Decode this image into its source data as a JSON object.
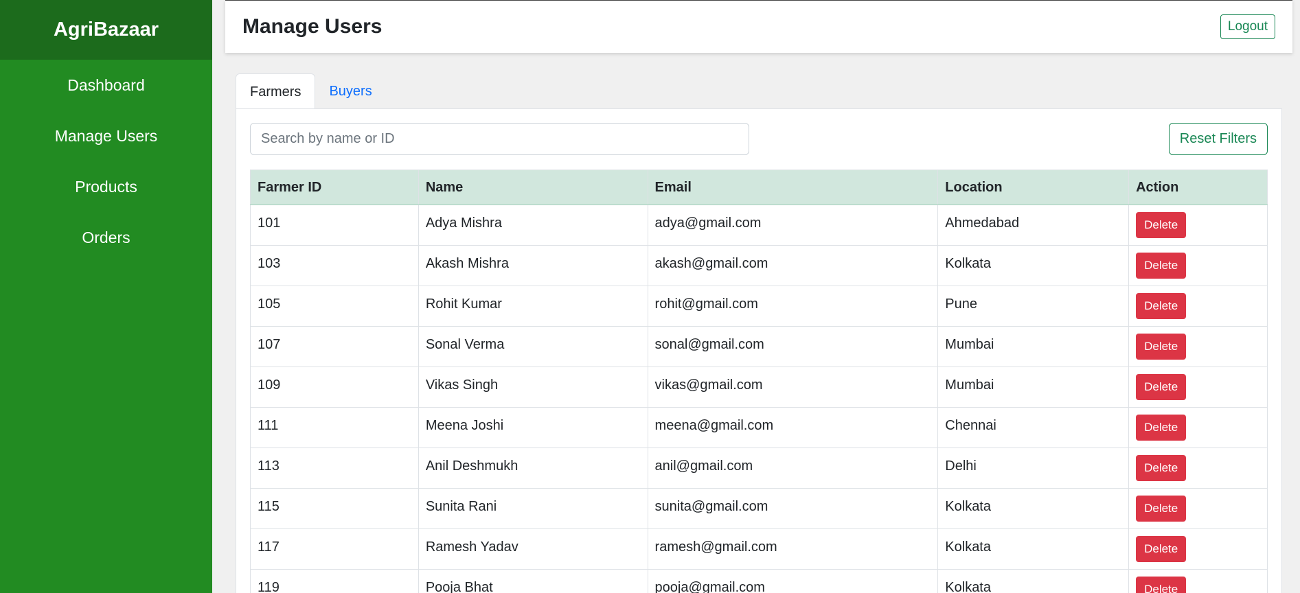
{
  "sidebar": {
    "brand": "AgriBazaar",
    "items": [
      {
        "label": "Dashboard"
      },
      {
        "label": "Manage Users"
      },
      {
        "label": "Products"
      },
      {
        "label": "Orders"
      }
    ]
  },
  "header": {
    "title": "Manage Users",
    "logout_label": "Logout"
  },
  "tabs": [
    {
      "label": "Farmers",
      "active": true
    },
    {
      "label": "Buyers",
      "active": false
    }
  ],
  "search": {
    "placeholder": "Search by name or ID",
    "value": ""
  },
  "reset_label": "Reset Filters",
  "table": {
    "columns": [
      "Farmer ID",
      "Name",
      "Email",
      "Location",
      "Action"
    ],
    "delete_label": "Delete",
    "rows": [
      {
        "id": "101",
        "name": "Adya Mishra",
        "email": "adya@gmail.com",
        "location": "Ahmedabad"
      },
      {
        "id": "103",
        "name": "Akash Mishra",
        "email": "akash@gmail.com",
        "location": "Kolkata"
      },
      {
        "id": "105",
        "name": "Rohit Kumar",
        "email": "rohit@gmail.com",
        "location": "Pune"
      },
      {
        "id": "107",
        "name": "Sonal Verma",
        "email": "sonal@gmail.com",
        "location": "Mumbai"
      },
      {
        "id": "109",
        "name": "Vikas Singh",
        "email": "vikas@gmail.com",
        "location": "Mumbai"
      },
      {
        "id": "111",
        "name": "Meena Joshi",
        "email": "meena@gmail.com",
        "location": "Chennai"
      },
      {
        "id": "113",
        "name": "Anil Deshmukh",
        "email": "anil@gmail.com",
        "location": "Delhi"
      },
      {
        "id": "115",
        "name": "Sunita Rani",
        "email": "sunita@gmail.com",
        "location": "Kolkata"
      },
      {
        "id": "117",
        "name": "Ramesh Yadav",
        "email": "ramesh@gmail.com",
        "location": "Kolkata"
      },
      {
        "id": "119",
        "name": "Pooja Bhat",
        "email": "pooja@gmail.com",
        "location": "Kolkata"
      }
    ]
  },
  "colors": {
    "sidebar": "#228b22",
    "brand_bg": "#1c6b1c",
    "header_row": "#d1e7dd",
    "danger": "#dc3545",
    "outline_success": "#198754",
    "link": "#0d6efd"
  }
}
